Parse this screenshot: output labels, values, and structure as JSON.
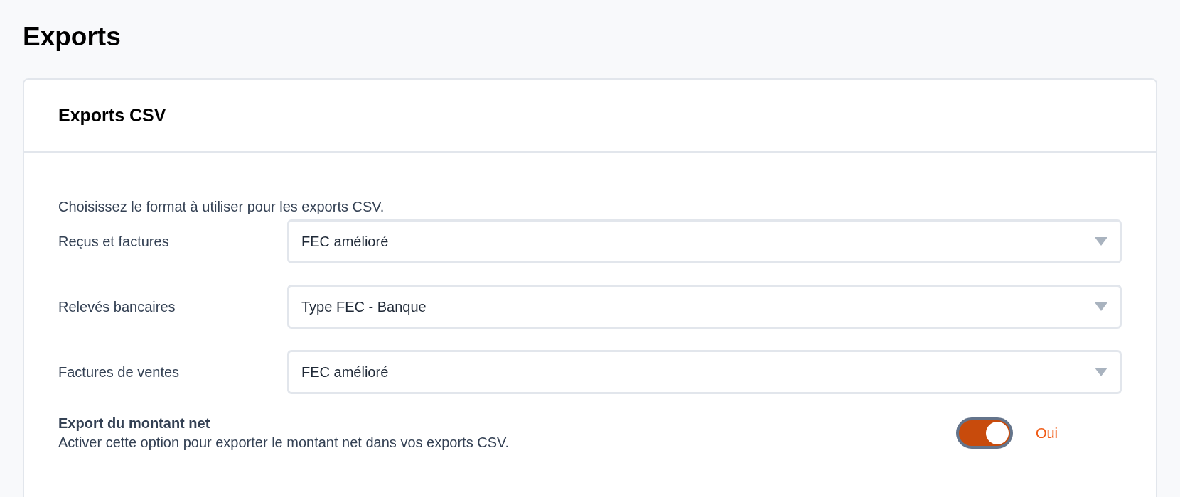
{
  "page": {
    "title": "Exports"
  },
  "card": {
    "title": "Exports CSV",
    "description": "Choisissez le format à utiliser pour les exports CSV.",
    "selects": [
      {
        "label": "Reçus et factures",
        "value": "FEC amélioré"
      },
      {
        "label": "Relevés bancaires",
        "value": "Type FEC - Banque"
      },
      {
        "label": "Factures de ventes",
        "value": "FEC amélioré"
      }
    ],
    "option": {
      "title": "Export du montant net",
      "description": "Activer cette option pour exporter le montant net dans vos exports CSV.",
      "on": true,
      "state_label": "Oui"
    }
  }
}
